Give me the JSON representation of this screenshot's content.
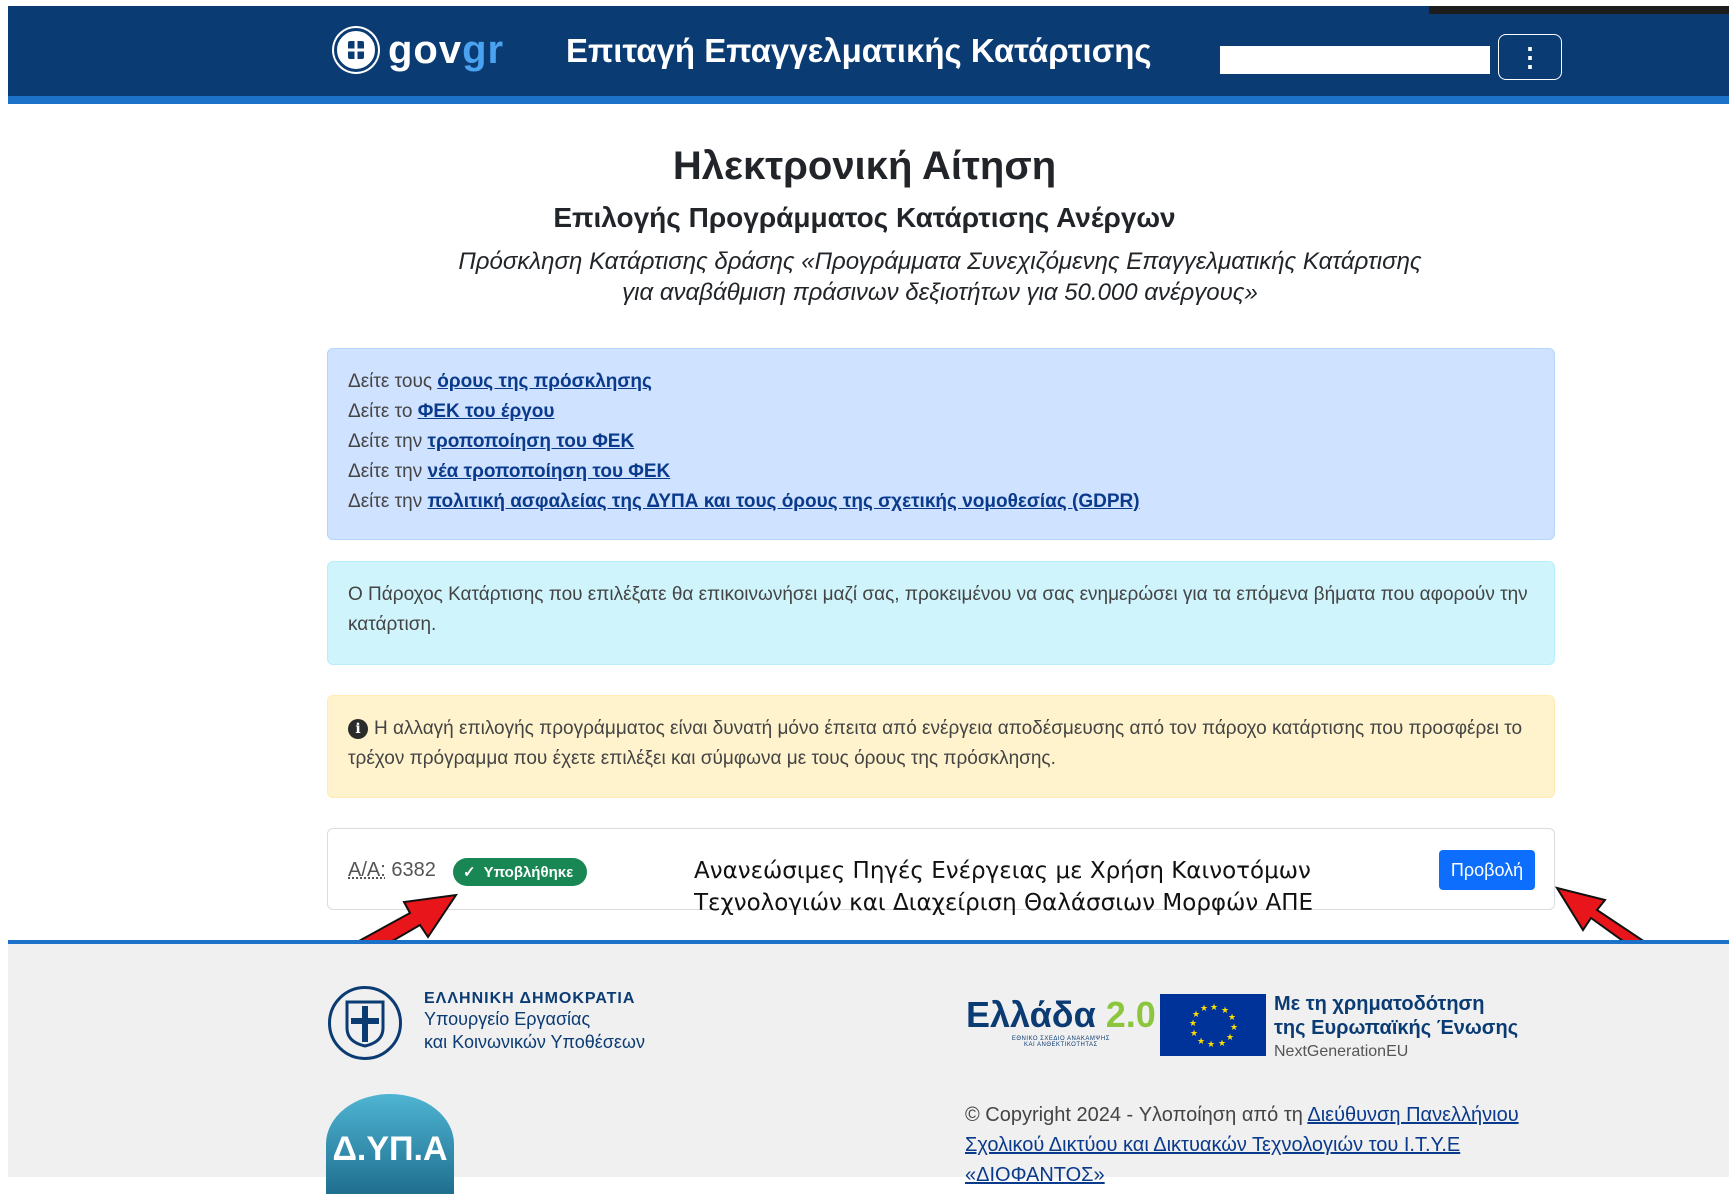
{
  "header": {
    "logo_gov": "gov",
    "logo_gr": "gr",
    "app_title": "Επιταγή Επαγγελματικής Κατάρτισης",
    "menu_icon": "kebab-menu-icon"
  },
  "main": {
    "title": "Ηλεκτρονική Αίτηση",
    "subtitle": "Επιλογής Προγράμματος Κατάρτισης Ανέργων",
    "invite_line1": "Πρόσκληση Κατάρτισης δράσης «Προγράμματα Συνεχιζόμενης Επαγγελματικής Κατάρτισης",
    "invite_line2": "για αναβάθμιση πράσινων δεξιοτήτων για 50.000 ανέργους»"
  },
  "links_alert": {
    "items": [
      {
        "prefix": "Δείτε τους ",
        "link": "όρους της πρόσκλησης"
      },
      {
        "prefix": "Δείτε το ",
        "link": "ΦΕΚ του έργου"
      },
      {
        "prefix": "Δείτε την ",
        "link": "τροποποίηση του ΦΕΚ"
      },
      {
        "prefix": "Δείτε την ",
        "link": "νέα τροποποίηση του ΦΕΚ"
      },
      {
        "prefix": "Δείτε την ",
        "link": "πολιτική ασφαλείας της ΔΥΠΑ και τους όρους της σχετικής νομοθεσίας (GDPR)"
      }
    ]
  },
  "info_alert": {
    "text": "Ο Πάροχος Κατάρτισης που επιλέξατε θα επικοινωνήσει μαζί σας, προκειμένου να σας ενημερώσει για τα επόμενα βήματα που αφορούν την κατάρτιση."
  },
  "warning_alert": {
    "icon": "info-circle-icon",
    "text": "Η αλλαγή επιλογής προγράμματος είναι δυνατή μόνο έπειτα από ενέργεια αποδέσμευσης από τον πάροχο κατάρτισης που προσφέρει το τρέχον πρόγραμμα που έχετε επιλέξει και σύμφωνα με τους όρους της πρόσκλησης."
  },
  "application_card": {
    "aa_label": "Α/Α:",
    "aa_value": "6382",
    "status": "Υποβλήθηκε",
    "program_line1": "Ανανεώσιμες Πηγές Ενέργειας με Χρήση Καινοτόμων",
    "program_line2": "Τεχνολογιών  και Διαχείριση Θαλάσσιων Μορφών ΑΠΕ",
    "view_button": "Προβολή"
  },
  "colors": {
    "header_bg": "#0b3b73",
    "accent_blue": "#1c71c8",
    "success_badge": "#198754",
    "primary_button": "#0d6efd",
    "arrow_red": "#e8161a"
  },
  "footer": {
    "ministry_line1": "ΕΛΛΗΝΙΚΗ ΔΗΜΟΚΡΑΤΙΑ",
    "ministry_line2": "Υπουργείο Εργασίας",
    "ministry_line3": "και Κοινωνικών Υποθέσεων",
    "dypa_logo": "Δ.ΥΠ.Α",
    "ellada_text": "Ελλάδα",
    "ellada_num": "2.0",
    "ellada_sub1": "ΕΘΝΙΚΟ ΣΧΕΔΙΟ ΑΝΑΚΑΜΨΗΣ",
    "ellada_sub2": "ΚΑΙ ΑΝΘΕΚΤΙΚΟΤΗΤΑΣ",
    "eu_line1": "Με τη χρηματοδότηση",
    "eu_line2": "της Ευρωπαϊκής Ένωσης",
    "eu_line3": "NextGenerationEU",
    "copyright_prefix": "© Copyright 2024 - Υλοποίηση από τη ",
    "copyright_link": "Διεύθυνση Πανελλήνιου Σχολικού Δικτύου και Δικτυακών Τεχνολογιών του Ι.Τ.Υ.Ε «ΔΙΟΦΑΝΤΟΣ»"
  }
}
